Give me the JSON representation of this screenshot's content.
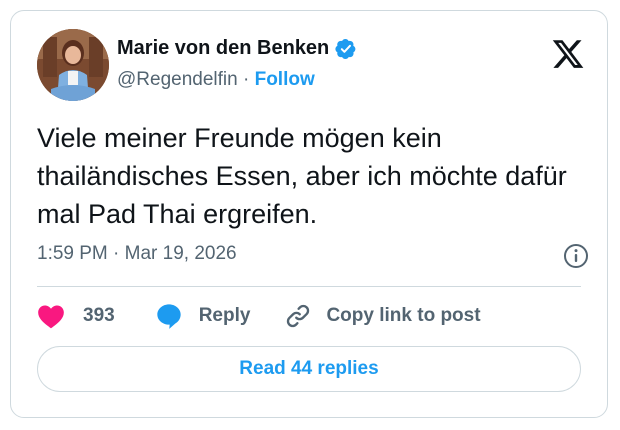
{
  "author": {
    "display_name": "Marie von den Benken",
    "handle": "@Regendelfin",
    "separator": " · ",
    "follow_label": "Follow",
    "verified": true
  },
  "tweet": {
    "text": "Viele meiner Freunde mögen kein thailändisches Essen, aber ich möchte dafür mal Pad Thai ergreifen.",
    "time": "1:59 PM",
    "date_separator": " · ",
    "date": "Mar 19, 2026"
  },
  "actions": {
    "like_count": "393",
    "reply_label": "Reply",
    "copy_link_label": "Copy link to post"
  },
  "footer": {
    "read_replies_label": "Read 44 replies"
  },
  "icons": {
    "logo": "x-logo-icon",
    "verified": "verified-badge-icon",
    "info": "info-icon",
    "like": "heart-icon",
    "reply": "speech-bubble-icon",
    "copy_link": "link-icon"
  },
  "colors": {
    "accent": "#1d9bf0",
    "like": "#f91880",
    "text": "#0f1419",
    "secondary_text": "#536471",
    "border": "#cfd9de"
  }
}
